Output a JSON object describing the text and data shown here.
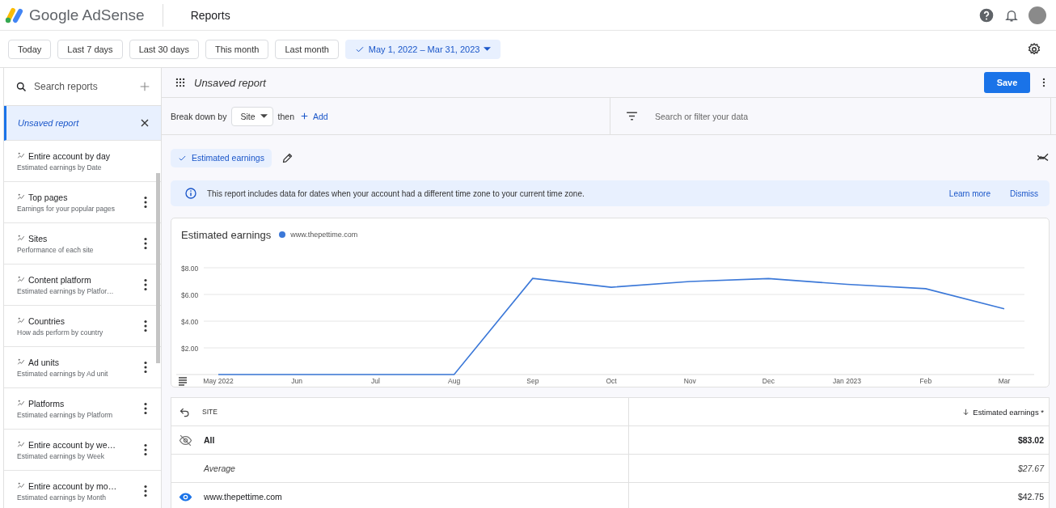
{
  "header": {
    "product": "Google AdSense",
    "page_title": "Reports"
  },
  "date_ranges": [
    {
      "label": "Today",
      "selected": false
    },
    {
      "label": "Last 7 days",
      "selected": false
    },
    {
      "label": "Last 30 days",
      "selected": false
    },
    {
      "label": "This month",
      "selected": false
    },
    {
      "label": "Last month",
      "selected": false
    },
    {
      "label": "May 1, 2022 – Mar 31, 2023",
      "selected": true
    }
  ],
  "sidebar": {
    "search_placeholder": "Search reports",
    "items": [
      {
        "title": "Unsaved report",
        "kind": "unsaved",
        "selected": true
      },
      {
        "title": "Entire account by day",
        "subtitle": "Estimated earnings by Date",
        "kind": "saved",
        "selected": false,
        "menu": false
      },
      {
        "title": "Top pages",
        "subtitle": "Earnings for your popular pages",
        "kind": "saved",
        "selected": false,
        "menu": true
      },
      {
        "title": "Sites",
        "subtitle": "Performance of each site",
        "kind": "saved",
        "selected": false,
        "menu": true
      },
      {
        "title": "Content platform",
        "subtitle": "Estimated earnings by Platfor…",
        "kind": "saved",
        "selected": false,
        "menu": true
      },
      {
        "title": "Countries",
        "subtitle": "How ads perform by country",
        "kind": "saved",
        "selected": false,
        "menu": true
      },
      {
        "title": "Ad units",
        "subtitle": "Estimated earnings by Ad unit",
        "kind": "saved",
        "selected": false,
        "menu": true
      },
      {
        "title": "Platforms",
        "subtitle": "Estimated earnings by Platform",
        "kind": "saved",
        "selected": false,
        "menu": true
      },
      {
        "title": "Entire account by we…",
        "subtitle": "Estimated earnings by Week",
        "kind": "saved",
        "selected": false,
        "menu": true
      },
      {
        "title": "Entire account by mo…",
        "subtitle": "Estimated earnings by Month",
        "kind": "saved",
        "selected": false,
        "menu": true
      }
    ]
  },
  "report": {
    "title": "Unsaved report",
    "save_label": "Save",
    "breakdown": {
      "label": "Break down by",
      "dimension": "Site",
      "then": "then",
      "add": "Add"
    },
    "filter_placeholder": "Search or filter your data",
    "metrics": [
      {
        "label": "Estimated earnings",
        "selected": true
      }
    ],
    "notice": {
      "text": "This report includes data for dates when your account had a different time zone to your current time zone.",
      "learn_more": "Learn more",
      "dismiss": "Dismiss"
    },
    "chart": {
      "title": "Estimated earnings",
      "chart_data": {
        "type": "line",
        "categories": [
          "May 2022",
          "Jun",
          "Jul",
          "Aug",
          "Sep",
          "Oct",
          "Nov",
          "Dec",
          "Jan 2023",
          "Feb",
          "Mar"
        ],
        "series": [
          {
            "name": "www.thepettime.com",
            "color": "#3b78d8",
            "values": [
              0,
              0,
              0,
              0,
              7.2,
              6.54,
              6.97,
              7.19,
              6.76,
              6.43,
              4.92
            ]
          }
        ],
        "ylim": [
          0,
          8
        ],
        "grid": true,
        "yticks": [
          {
            "value": 2,
            "label": "$2.00"
          },
          {
            "value": 4,
            "label": "$4.00"
          },
          {
            "value": 6,
            "label": "$6.00"
          },
          {
            "value": 8,
            "label": "$8.00"
          }
        ]
      }
    },
    "table": {
      "columns": [
        "SITE",
        "Estimated earnings *"
      ],
      "rows": [
        {
          "kind": "total",
          "site": "All",
          "earnings": "$83.02"
        },
        {
          "kind": "average",
          "site": "Average",
          "earnings": "$27.67"
        },
        {
          "kind": "site",
          "site": "www.thepettime.com",
          "earnings": "$42.75"
        }
      ]
    }
  }
}
